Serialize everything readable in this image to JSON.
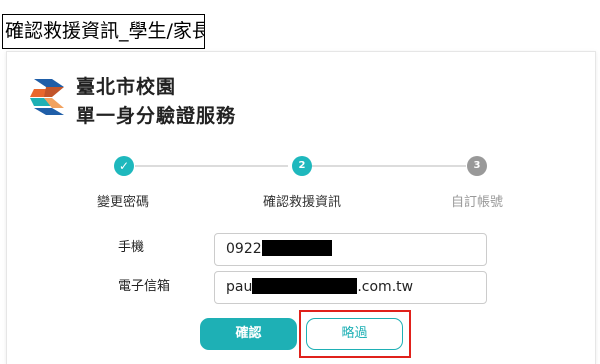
{
  "caption": "確認救援資訊_學生/家長",
  "brand": {
    "line1": "臺北市校園",
    "line2": "單一身分驗證服務",
    "colors": {
      "blue": "#1f5ea8",
      "orange": "#e8682d",
      "teal": "#1eb0b5"
    }
  },
  "steps": [
    {
      "number": "✓",
      "label": "變更密碼",
      "state": "done"
    },
    {
      "number": "2",
      "label": "確認救援資訊",
      "state": "current"
    },
    {
      "number": "3",
      "label": "自訂帳號",
      "state": "pending"
    }
  ],
  "form": {
    "phone_label": "手機",
    "phone_value_prefix": "0922",
    "email_label": "電子信箱",
    "email_value_prefix": "pau",
    "email_value_suffix": ".com.tw"
  },
  "buttons": {
    "confirm": "確認",
    "skip": "略過"
  },
  "accent_color": "#1eb0b5",
  "highlight_color": "#e0211b"
}
